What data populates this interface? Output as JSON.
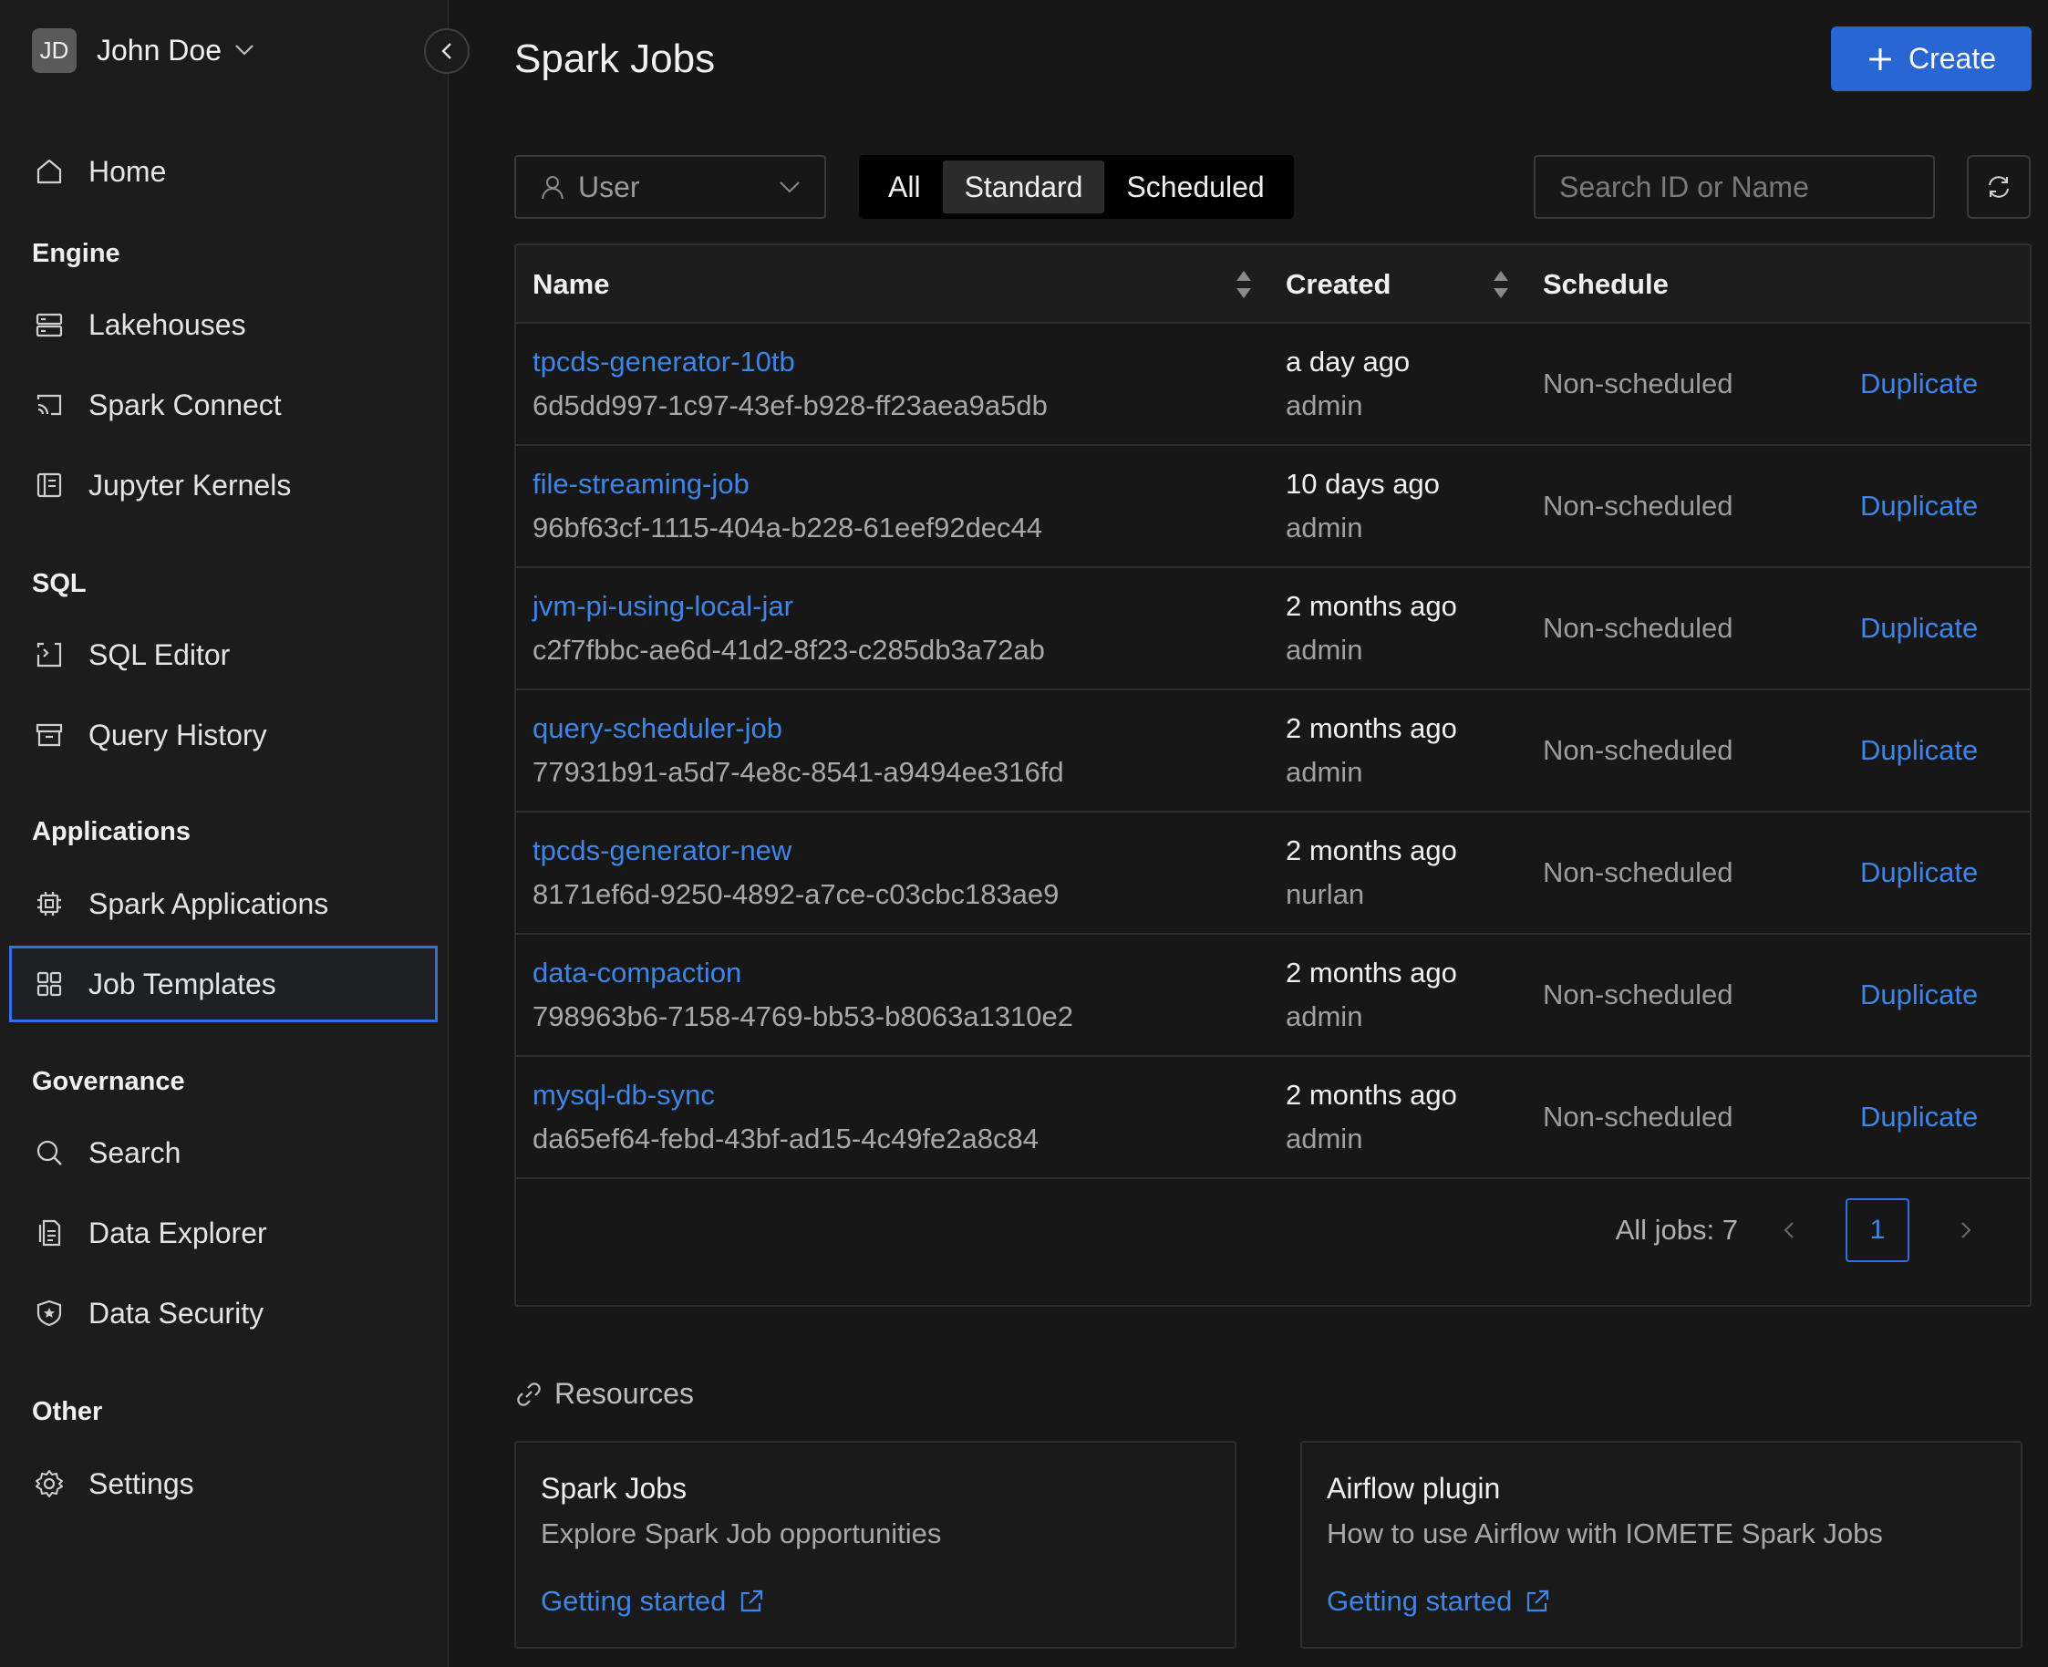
{
  "user": {
    "initials": "JD",
    "name": "John Doe"
  },
  "sidebar": {
    "home": "Home",
    "sections": {
      "engine": "Engine",
      "sql": "SQL",
      "applications": "Applications",
      "governance": "Governance",
      "other": "Other"
    },
    "items": {
      "lakehouses": "Lakehouses",
      "spark_connect": "Spark Connect",
      "jupyter_kernels": "Jupyter Kernels",
      "sql_editor": "SQL Editor",
      "query_history": "Query History",
      "spark_applications": "Spark Applications",
      "job_templates": "Job Templates",
      "search": "Search",
      "data_explorer": "Data Explorer",
      "data_security": "Data Security",
      "settings": "Settings"
    },
    "active_item": "job_templates"
  },
  "header": {
    "title": "Spark Jobs",
    "create_label": "Create"
  },
  "filters": {
    "user_placeholder": "User",
    "tabs": [
      "All",
      "Standard",
      "Scheduled"
    ],
    "active_tab": "Standard",
    "search_placeholder": "Search ID or Name"
  },
  "table": {
    "columns": {
      "name": "Name",
      "created": "Created",
      "schedule": "Schedule"
    },
    "rows": [
      {
        "name": "tpcds-generator-10tb",
        "id": "6d5dd997-1c97-43ef-b928-ff23aea9a5db",
        "created": "a day ago",
        "by": "admin",
        "schedule": "Non-scheduled",
        "action": "Duplicate"
      },
      {
        "name": "file-streaming-job",
        "id": "96bf63cf-1115-404a-b228-61eef92dec44",
        "created": "10 days ago",
        "by": "admin",
        "schedule": "Non-scheduled",
        "action": "Duplicate"
      },
      {
        "name": "jvm-pi-using-local-jar",
        "id": "c2f7fbbc-ae6d-41d2-8f23-c285db3a72ab",
        "created": "2 months ago",
        "by": "admin",
        "schedule": "Non-scheduled",
        "action": "Duplicate"
      },
      {
        "name": "query-scheduler-job",
        "id": "77931b91-a5d7-4e8c-8541-a9494ee316fd",
        "created": "2 months ago",
        "by": "admin",
        "schedule": "Non-scheduled",
        "action": "Duplicate"
      },
      {
        "name": "tpcds-generator-new",
        "id": "8171ef6d-9250-4892-a7ce-c03cbc183ae9",
        "created": "2 months ago",
        "by": "nurlan",
        "schedule": "Non-scheduled",
        "action": "Duplicate"
      },
      {
        "name": "data-compaction",
        "id": "798963b6-7158-4769-bb53-b8063a1310e2",
        "created": "2 months ago",
        "by": "admin",
        "schedule": "Non-scheduled",
        "action": "Duplicate"
      },
      {
        "name": "mysql-db-sync",
        "id": "da65ef64-febd-43bf-ad15-4c49fe2a8c84",
        "created": "2 months ago",
        "by": "admin",
        "schedule": "Non-scheduled",
        "action": "Duplicate"
      }
    ]
  },
  "pagination": {
    "total_label": "All jobs: 7",
    "current_page": "1"
  },
  "resources": {
    "title": "Resources",
    "cards": [
      {
        "title": "Spark Jobs",
        "desc": "Explore Spark Job opportunities",
        "link": "Getting started"
      },
      {
        "title": "Airflow plugin",
        "desc": "How to use Airflow with IOMETE Spark Jobs",
        "link": "Getting started"
      }
    ]
  },
  "colors": {
    "accent": "#2866d4",
    "link": "#3d86e8",
    "background": "#171717",
    "sidebar": "#1c1c1c",
    "border": "#2e2e2e"
  },
  "icons": [
    "home-icon",
    "lakehouse-icon",
    "spark-connect-icon",
    "jupyter-icon",
    "sql-editor-icon",
    "query-history-icon",
    "spark-apps-icon",
    "job-templates-icon",
    "search-icon",
    "data-explorer-icon",
    "data-security-icon",
    "settings-icon",
    "user-icon",
    "refresh-icon",
    "plus-icon",
    "link-icon",
    "external-link-icon",
    "sort-icon",
    "chevron-left-icon",
    "chevron-right-icon",
    "chevron-down-icon"
  ]
}
